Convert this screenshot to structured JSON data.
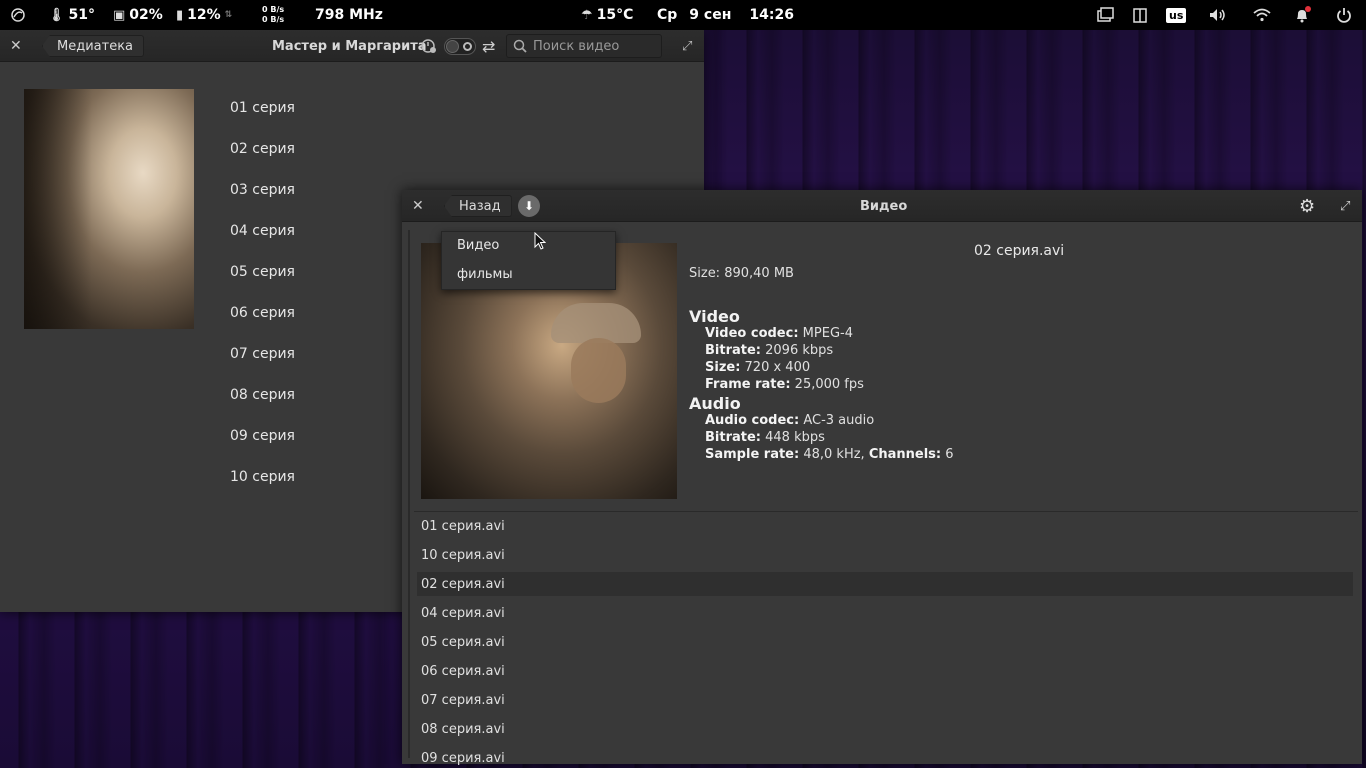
{
  "top_panel": {
    "cpu_temp": "51°",
    "cpu_load": "02%",
    "mem_load": "12%",
    "net_up": "0 B/s",
    "net_down": "0 B/s",
    "cpu_freq": "798 MHz",
    "weather": "15°C",
    "day": "Ср",
    "date": "9 сен",
    "time": "14:26",
    "keyboard_layout": "us"
  },
  "library_window": {
    "back_label": "Медиатека",
    "title": "Мастер и Маргарита",
    "search_placeholder": "Поиск видео",
    "episodes": [
      "01 серия",
      "02 серия",
      "03 серия",
      "04 серия",
      "05 серия",
      "06 серия",
      "07 серия",
      "08 серия",
      "09 серия",
      "10 серия"
    ]
  },
  "video_window": {
    "back_label": "Назад",
    "title": "Видео",
    "dropdown": [
      "Видео",
      "фильмы"
    ],
    "file_title": "02 серия.avi",
    "size_line": "Size: 890,40 MB",
    "video_heading": "Video",
    "video": [
      {
        "k": "Video codec:",
        "v": " MPEG-4"
      },
      {
        "k": "Bitrate:",
        "v": " 2096 kbps"
      },
      {
        "k": "Size:",
        "v": " 720 x 400"
      },
      {
        "k": "Frame rate:",
        "v": " 25,000 fps"
      }
    ],
    "audio_heading": "Audio",
    "audio": [
      {
        "k": "Audio codec:",
        "v": " AC-3 audio"
      },
      {
        "k": "Bitrate:",
        "v": " 448 kbps"
      },
      {
        "k": "Sample rate:",
        "v": " 48,0 kHz, ",
        "k2": "Channels:",
        "v2": " 6"
      }
    ],
    "files": [
      "01 серия.avi",
      "10 серия.avi",
      "02 серия.avi",
      "04 серия.avi",
      "05 серия.avi",
      "06 серия.avi",
      "07 серия.avi",
      "08 серия.avi",
      "09 серия.avi"
    ],
    "selected_file_index": 2
  }
}
